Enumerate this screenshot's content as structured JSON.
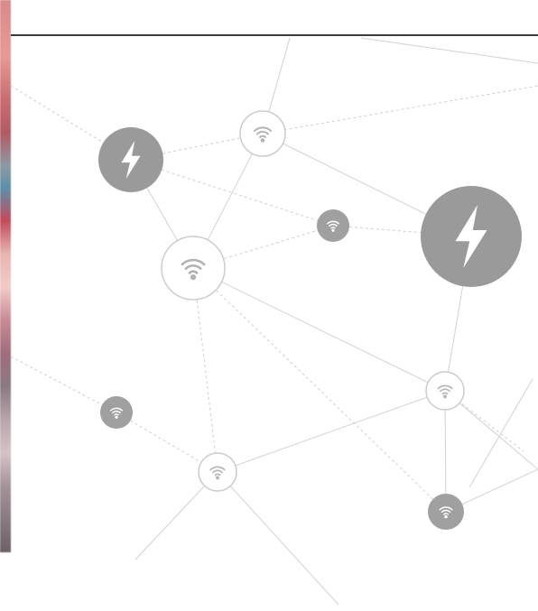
{
  "palette": {
    "line": "#cfcfcf",
    "dashed_line": "#cccccc",
    "node_fill_dark": "#999999",
    "node_fill_light": "#ffffff",
    "node_stroke": "#c9c9c9",
    "icon_light": "#b3b3b3",
    "icon_dark": "#ffffff",
    "rule": "#3a3a3a"
  },
  "nodes": [
    {
      "name": "power-node-left",
      "kind": "power",
      "style": "dark"
    },
    {
      "name": "wifi-node-top",
      "kind": "wifi",
      "style": "light"
    },
    {
      "name": "wifi-node-center-small",
      "kind": "wifi",
      "style": "dark"
    },
    {
      "name": "power-node-right-large",
      "kind": "power",
      "style": "dark"
    },
    {
      "name": "wifi-node-hub",
      "kind": "wifi",
      "style": "light"
    },
    {
      "name": "wifi-node-right-mid",
      "kind": "wifi",
      "style": "light"
    },
    {
      "name": "wifi-node-left-low",
      "kind": "wifi",
      "style": "dark"
    },
    {
      "name": "wifi-node-bottom",
      "kind": "wifi",
      "style": "light"
    },
    {
      "name": "wifi-node-bottom-right",
      "kind": "wifi",
      "style": "dark"
    }
  ]
}
